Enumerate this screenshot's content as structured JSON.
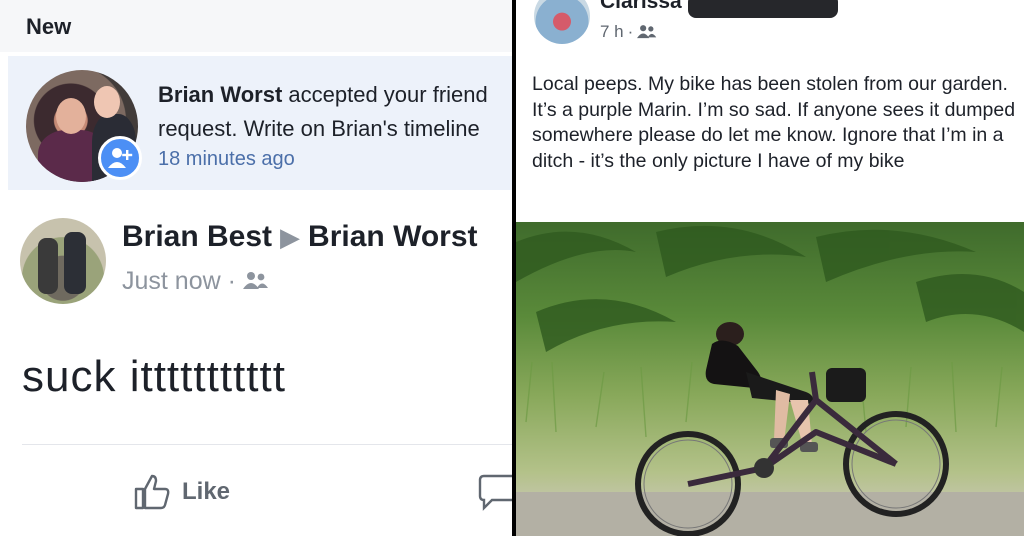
{
  "left_panel": {
    "section_header": "New",
    "notification": {
      "actor": "Brian Worst",
      "text_line1_rest": " accepted your friend",
      "text_line2": "request. Write on Brian's timeline",
      "time": "18 minutes ago"
    },
    "post": {
      "author": "Brian Best",
      "target": "Brian Worst",
      "time": "Just now",
      "body": "suck ittttttttttt",
      "like_label": "Like"
    }
  },
  "right_panel": {
    "author_name": "Clarissa",
    "time": "7 h",
    "text": "Local peeps. My bike has been stolen from our garden. It’s a purple Marin.  I’m so sad.  If anyone sees it dumped somewhere please do let me know. Ignore that I’m in a ditch - it’s the only picture I have of my bike"
  },
  "colors": {
    "facebook_blue": "#4c8ff5",
    "notification_bg": "#edf2fa",
    "link_blue": "#4b6fa9",
    "text_dark": "#1d2129",
    "text_grey": "#8d949e"
  },
  "icons": [
    "add-friend-icon",
    "friends-audience-icon",
    "thumbs-up-icon",
    "comment-icon"
  ]
}
